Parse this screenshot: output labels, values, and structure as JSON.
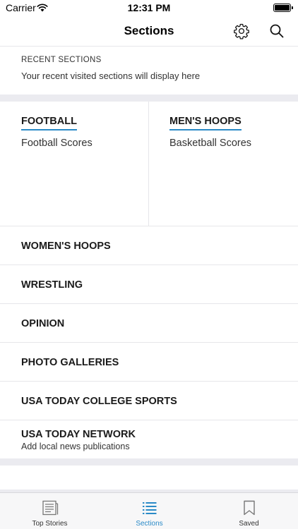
{
  "status_bar": {
    "carrier": "Carrier",
    "time": "12:31 PM"
  },
  "nav": {
    "title": "Sections"
  },
  "recent": {
    "title": "RECENT SECTIONS",
    "text": "Your recent visited sections will display here"
  },
  "featured": [
    {
      "title": "FOOTBALL",
      "subtitle": "Football Scores"
    },
    {
      "title": "MEN'S HOOPS",
      "subtitle": "Basketball Scores"
    }
  ],
  "sections": [
    {
      "label": "WOMEN'S HOOPS"
    },
    {
      "label": "WRESTLING"
    },
    {
      "label": "OPINION"
    },
    {
      "label": "PHOTO GALLERIES"
    },
    {
      "label": "USA TODAY COLLEGE SPORTS"
    }
  ],
  "network": {
    "label": "USA TODAY NETWORK",
    "subtitle": "Add local news publications"
  },
  "tabs": [
    {
      "label": "Top Stories",
      "icon": "newspaper-icon",
      "active": false
    },
    {
      "label": "Sections",
      "icon": "list-icon",
      "active": true
    },
    {
      "label": "Saved",
      "icon": "bookmark-icon",
      "active": false
    }
  ],
  "colors": {
    "accent": "#2a8ac7",
    "separator": "#ebebf0"
  }
}
